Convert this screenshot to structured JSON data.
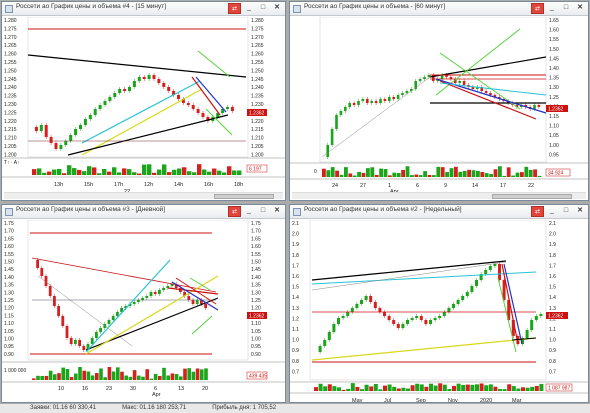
{
  "windows": [
    {
      "title": "Россети ао График цены и объема #4 - [15 минут]",
      "price_axis": [
        "1.280",
        "1.275",
        "1.270",
        "1.265",
        "1.260",
        "1.255",
        "1.250",
        "1.245",
        "1.240",
        "1.235",
        "1.230",
        "1.225",
        "1.220",
        "1.215",
        "1.210",
        "1.205",
        "1.200"
      ],
      "left_axis": [
        "1.280",
        "1.275",
        "1.270",
        "1.265",
        "1.260",
        "1.255",
        "1.250",
        "1.245",
        "1.240",
        "1.235",
        "1.230",
        "1.225",
        "1.220",
        "1.215",
        "1.210",
        "1.205",
        "1.200"
      ],
      "price_badge": "1.2362",
      "volume_badge": "6 197",
      "time_labels": [
        "13h",
        "15h",
        "17h",
        "12h",
        "14h",
        "16h",
        "18h"
      ],
      "date_label": "22",
      "indicator_label": "T↑ · A↑"
    },
    {
      "title": "Россети ао График цены и объема - [60 минут]",
      "price_axis": [
        "1.65",
        "1.60",
        "1.55",
        "1.50",
        "1.45",
        "1.40",
        "1.35",
        "1.30",
        "1.25",
        "1.20",
        "1.15",
        "1.10",
        "1.05",
        "1.00",
        "0.95"
      ],
      "price_badge": "1.2362",
      "volume_badge": "34 924",
      "volume_axis": "0",
      "time_labels": [
        "24",
        "27",
        "1",
        "6",
        "9",
        "14",
        "17",
        "22"
      ],
      "date_label": "Apr"
    },
    {
      "title": "Россети ао График цены и объема #3 - [Дневной]",
      "price_axis": [
        "1.75",
        "1.70",
        "1.65",
        "1.60",
        "1.55",
        "1.50",
        "1.45",
        "1.40",
        "1.35",
        "1.30",
        "1.25",
        "1.20",
        "1.15",
        "1.10",
        "1.05",
        "1.00",
        "0.95",
        "0.90"
      ],
      "price_badge": "1.2362",
      "volume_axis": "1 000 000",
      "volume_badge": "439 435",
      "time_labels": [
        "10",
        "16",
        "23",
        "30",
        "6",
        "13",
        "20"
      ],
      "date_label": "Apr"
    },
    {
      "title": "Россети ао График цены и объема #2 - [Недельный]",
      "price_axis": [
        "2.1",
        "2.0",
        "1.9",
        "1.8",
        "1.7",
        "1.6",
        "1.5",
        "1.4",
        "1.3",
        "1.2",
        "1.1",
        "1.0",
        "0.9",
        "0.8",
        "0.7"
      ],
      "price_badge": "1.2362",
      "volume_badge": "1 087 987",
      "time_labels": [
        "May",
        "Jul",
        "Sep",
        "Nov",
        "2020",
        "Mar"
      ],
      "year_label": "2020"
    }
  ],
  "status_bar": {
    "items": [
      "Заявки: 01.16  60 330,41",
      "Макс: 01.16  180 253,71",
      "Прибыль дня: 1 705,52"
    ]
  },
  "colors": {
    "background": "#ABABAB",
    "candle_up": "#1aa51a",
    "candle_down": "#d62020",
    "trend_black": "#000000",
    "trend_cyan": "#27c4d6",
    "trend_yellow": "#d8d81a",
    "trend_green": "#56d23c",
    "trend_red": "#cc1111",
    "trend_blue": "#2233cc",
    "badge": "#cc1111"
  }
}
